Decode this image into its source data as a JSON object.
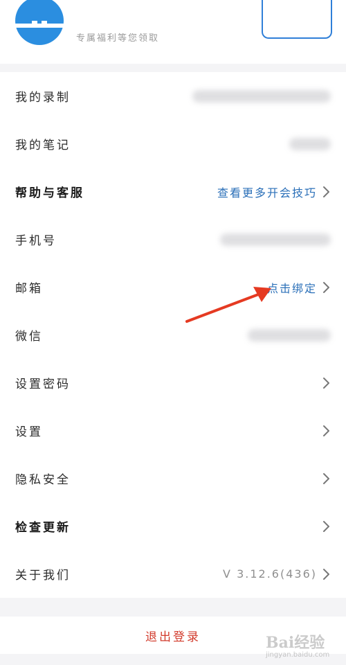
{
  "header": {
    "promo_text": "专属福利等您领取"
  },
  "menu": [
    {
      "label": "我的录制",
      "bold": false,
      "value": "",
      "link": false,
      "blurred": true,
      "chevron": false
    },
    {
      "label": "我的笔记",
      "bold": false,
      "value": "",
      "link": false,
      "blurred": true,
      "chevron": false
    },
    {
      "label": "帮助与客服",
      "bold": true,
      "value": "查看更多开会技巧",
      "link": true,
      "blurred": false,
      "chevron": true
    },
    {
      "label": "手机号",
      "bold": false,
      "value": "",
      "link": false,
      "blurred": true,
      "chevron": false
    },
    {
      "label": "邮箱",
      "bold": false,
      "value": "点击绑定",
      "link": true,
      "blurred": false,
      "chevron": true
    },
    {
      "label": "微信",
      "bold": false,
      "value": "",
      "link": false,
      "blurred": true,
      "chevron": false
    },
    {
      "label": "设置密码",
      "bold": false,
      "value": "",
      "link": false,
      "blurred": false,
      "chevron": true
    },
    {
      "label": "设置",
      "bold": false,
      "value": "",
      "link": false,
      "blurred": false,
      "chevron": true
    },
    {
      "label": "隐私安全",
      "bold": false,
      "value": "",
      "link": false,
      "blurred": false,
      "chevron": true
    },
    {
      "label": "检查更新",
      "bold": true,
      "value": "",
      "link": false,
      "blurred": false,
      "chevron": true
    },
    {
      "label": "关于我们",
      "bold": false,
      "value": "V 3.12.6(436)",
      "link": false,
      "blurred": false,
      "chevron": true
    }
  ],
  "logout_label": "退出登录",
  "watermark": {
    "brand": "Bai经验",
    "sub": "jingyan.baidu.com"
  },
  "colors": {
    "accent_blue": "#2a6fb8",
    "logout_red": "#d23b2c",
    "annotation_arrow": "#e53a22"
  },
  "icons": {
    "back": "chevron-left-icon",
    "row": "chevron-right-icon"
  }
}
